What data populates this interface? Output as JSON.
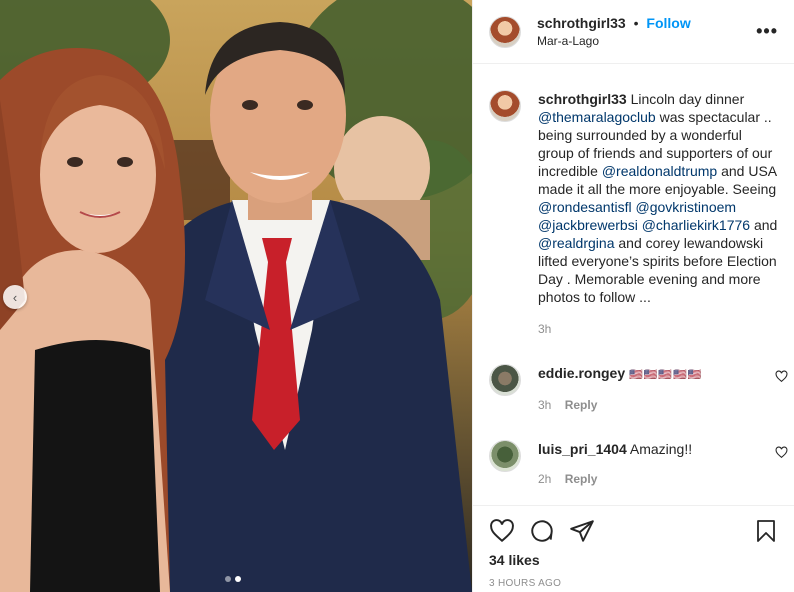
{
  "post": {
    "username": "schrothgirl33",
    "follow_label": "Follow",
    "separator": "•",
    "location": "Mar-a-Lago",
    "more_label": "•••"
  },
  "caption": {
    "username": "schrothgirl33",
    "text_1": "Lincoln day dinner",
    "mention_1": "@themaralagoclub",
    "text_2": "was spectacular .. being surrounded by a wonderful group of friends and supporters of our incredible",
    "mention_2": "@realdonaldtrump",
    "text_3": "and USA made it all the more enjoyable. Seeing",
    "mention_3": "@rondesantisfl",
    "mention_4": "@govkristinoem",
    "mention_5": "@jackbrewerbsi",
    "mention_6": "@charliekirk1776",
    "text_4": "and",
    "mention_7": "@realdrgina",
    "text_5": "and corey lewandowski lifted everyone’s spirits before Election Day . Memorable evening and more photos to follow ...",
    "time": "3h"
  },
  "comments": [
    {
      "username": "eddie.rongey",
      "text": "🇺🇸🇺🇸🇺🇸🇺🇸🇺🇸",
      "time": "3h",
      "reply_label": "Reply"
    },
    {
      "username": "luis_pri_1404",
      "text": "Amazing!!",
      "time": "2h",
      "reply_label": "Reply"
    }
  ],
  "footer": {
    "likes": "34 likes",
    "posted": "3 HOURS AGO"
  },
  "carousel": {
    "prev_glyph": "‹",
    "current_slide": 2,
    "total_slides": 2
  },
  "colors": {
    "link": "#00376b",
    "follow": "#0095f6",
    "muted": "#8e8e8e"
  }
}
